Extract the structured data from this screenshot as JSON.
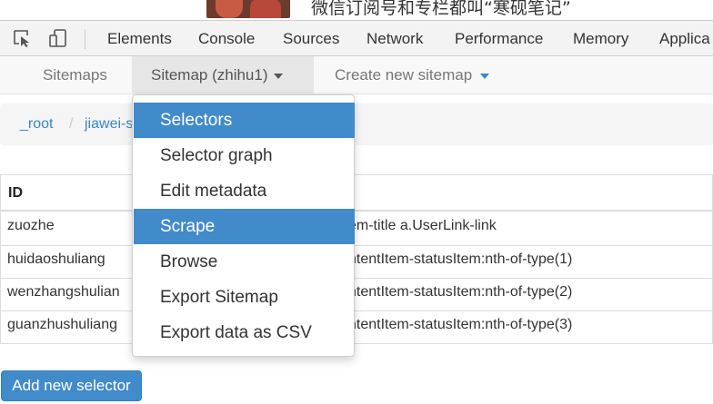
{
  "page": {
    "text": "微信订阅号和专栏都叫“寒砚笔记”"
  },
  "devtools": {
    "tabs": [
      "Elements",
      "Console",
      "Sources",
      "Network",
      "Performance",
      "Memory",
      "Applica"
    ]
  },
  "scraper_nav": {
    "sitemaps": "Sitemaps",
    "sitemap_menu": "Sitemap (zhihu1)",
    "create": "Create new sitemap"
  },
  "breadcrumb": {
    "root": "_root",
    "sep": "/",
    "current": "jiawei-s"
  },
  "table": {
    "header": [
      "ID"
    ],
    "rows": [
      {
        "id": "zuozhe",
        "selector": "em-title a.UserLink-link"
      },
      {
        "id": "huidaoshuliang",
        "selector": "ntentItem-statusItem:nth-of-type(1)"
      },
      {
        "id": "wenzhangshulian",
        "selector": "ntentItem-statusItem:nth-of-type(2)"
      },
      {
        "id": "guanzhushuliang",
        "selector": "ntentItem-statusItem:nth-of-type(3)"
      }
    ]
  },
  "add_selector": "Add new selector",
  "dropdown": {
    "items": [
      "Selectors",
      "Selector graph",
      "Edit metadata",
      "Scrape",
      "Browse",
      "Export Sitemap",
      "Export data as CSV"
    ]
  },
  "colors": {
    "accent": "#428bca",
    "link": "#3a87c4"
  }
}
